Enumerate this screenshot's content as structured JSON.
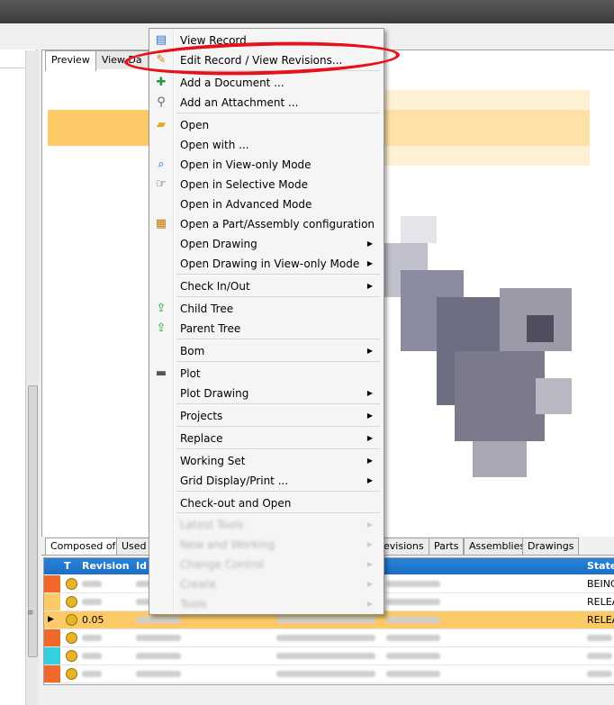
{
  "preview_tabs": [
    "Preview",
    "View Da"
  ],
  "context_menu": {
    "items": [
      {
        "label": "View Record",
        "icon": "view-record-icon",
        "submenu": false,
        "disabled": false
      },
      {
        "label": "Edit Record / View Revisions...",
        "icon": "edit-record-icon",
        "submenu": false,
        "disabled": false
      },
      {
        "label": "Add a Document ...",
        "icon": "add-document-icon",
        "submenu": false,
        "disabled": false
      },
      {
        "label": "Add an Attachment ...",
        "icon": "paperclip-icon",
        "submenu": false,
        "disabled": false
      },
      {
        "label": "Open",
        "icon": "open-folder-icon",
        "submenu": false,
        "disabled": false
      },
      {
        "label": "Open with ...",
        "icon": "",
        "submenu": false,
        "disabled": false
      },
      {
        "label": "Open in View-only Mode",
        "icon": "view-only-icon",
        "submenu": false,
        "disabled": false
      },
      {
        "label": "Open in Selective Mode",
        "icon": "selective-mode-icon",
        "submenu": false,
        "disabled": false
      },
      {
        "label": "Open in Advanced Mode",
        "icon": "",
        "submenu": false,
        "disabled": false
      },
      {
        "label": "Open a Part/Assembly configuration",
        "icon": "configuration-icon",
        "submenu": false,
        "disabled": false
      },
      {
        "label": "Open Drawing",
        "icon": "",
        "submenu": true,
        "disabled": false
      },
      {
        "label": "Open Drawing in View-only Mode",
        "icon": "",
        "submenu": true,
        "disabled": false
      },
      {
        "label": "Check In/Out",
        "icon": "",
        "submenu": true,
        "disabled": false
      },
      {
        "label": "Child Tree",
        "icon": "child-tree-icon",
        "submenu": false,
        "disabled": false
      },
      {
        "label": "Parent Tree",
        "icon": "parent-tree-icon",
        "submenu": false,
        "disabled": false
      },
      {
        "label": "Bom",
        "icon": "",
        "submenu": true,
        "disabled": false
      },
      {
        "label": "Plot",
        "icon": "printer-icon",
        "submenu": false,
        "disabled": false
      },
      {
        "label": "Plot Drawing",
        "icon": "",
        "submenu": true,
        "disabled": false
      },
      {
        "label": "Projects",
        "icon": "",
        "submenu": true,
        "disabled": false
      },
      {
        "label": "Replace",
        "icon": "",
        "submenu": true,
        "disabled": false
      },
      {
        "label": "Working Set",
        "icon": "",
        "submenu": true,
        "disabled": false
      },
      {
        "label": "Grid Display/Print ...",
        "icon": "",
        "submenu": true,
        "disabled": false
      },
      {
        "label": "Check-out and Open",
        "icon": "",
        "submenu": false,
        "disabled": false
      },
      {
        "label": "Latest Tools",
        "icon": "",
        "submenu": false,
        "disabled": true
      },
      {
        "label": "New and Working",
        "icon": "",
        "submenu": false,
        "disabled": true
      },
      {
        "label": "Change Control",
        "icon": "",
        "submenu": false,
        "disabled": true
      },
      {
        "label": "Create",
        "icon": "",
        "submenu": false,
        "disabled": true
      },
      {
        "label": "Tools",
        "icon": "",
        "submenu": false,
        "disabled": true
      }
    ]
  },
  "bottom_tabs": [
    "Composed of:",
    "Used b",
    "evisions",
    "Parts",
    "Assemblies",
    "Drawings"
  ],
  "grid": {
    "columns": [
      "T",
      "Revision",
      "Id",
      "State"
    ],
    "rows": [
      {
        "revision": "",
        "state": "BEING_",
        "strip_color": "#f2682a",
        "selected": false
      },
      {
        "revision": "",
        "state": "RELEA",
        "strip_color": "#fccb68",
        "selected": false
      },
      {
        "revision": "0.05",
        "state": "RELEA",
        "strip_color": "#fccb68",
        "selected": true
      },
      {
        "revision": "",
        "state": "",
        "strip_color": "#f2682a",
        "selected": false
      },
      {
        "revision": "",
        "state": "",
        "strip_color": "#33d0e0",
        "selected": false
      },
      {
        "revision": "",
        "state": "",
        "strip_color": "#f2682a",
        "selected": false
      }
    ]
  },
  "colors": {
    "highlight": "#fccb68",
    "annotation_oval": "#e8101a",
    "grid_header": "#1f76cc"
  }
}
